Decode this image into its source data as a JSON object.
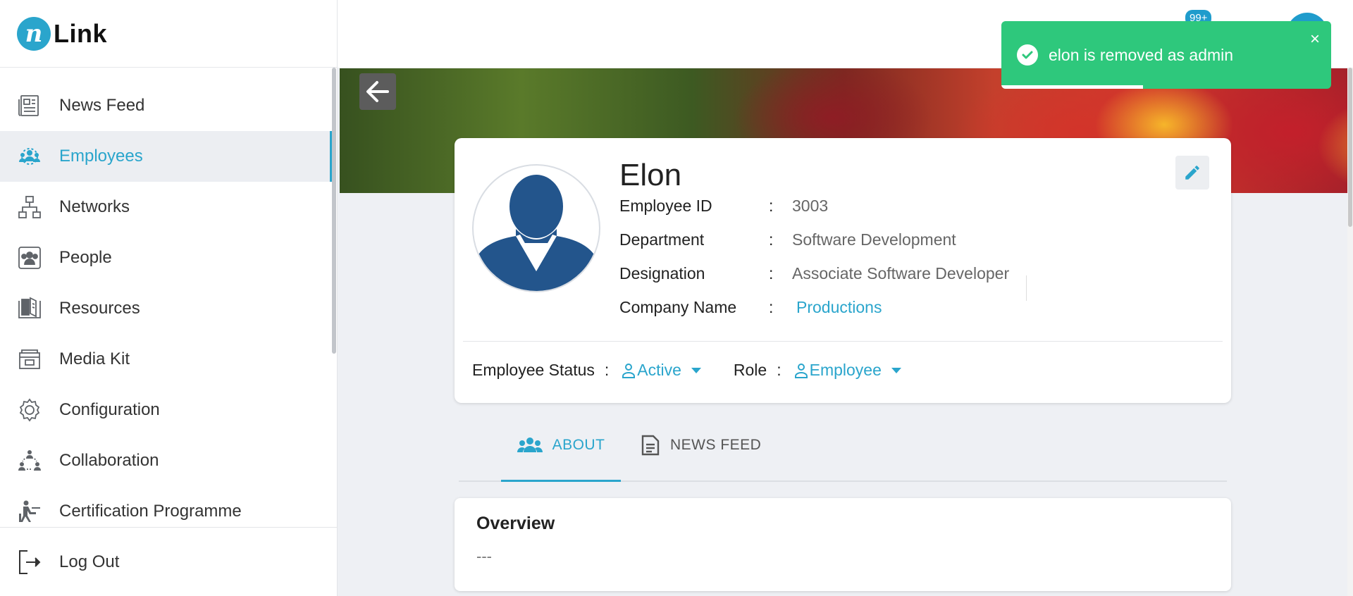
{
  "app": {
    "logo_text": "Link"
  },
  "sidebar": {
    "items": [
      {
        "label": "News Feed",
        "icon": "newspaper-icon"
      },
      {
        "label": "Employees",
        "icon": "employees-icon",
        "active": true
      },
      {
        "label": "Networks",
        "icon": "network-icon"
      },
      {
        "label": "People",
        "icon": "people-icon"
      },
      {
        "label": "Resources",
        "icon": "book-icon"
      },
      {
        "label": "Media Kit",
        "icon": "media-kit-icon"
      },
      {
        "label": "Configuration",
        "icon": "gear-icon"
      },
      {
        "label": "Collaboration",
        "icon": "collaboration-icon"
      },
      {
        "label": "Certification Programme",
        "icon": "certification-icon"
      }
    ],
    "logout_label": "Log Out"
  },
  "topbar": {
    "notification_count": "99+"
  },
  "profile": {
    "name": "Elon",
    "fields": [
      {
        "label": "Employee ID",
        "value": "3003"
      },
      {
        "label": "Department",
        "value": "Software Development"
      },
      {
        "label": "Designation",
        "value": "Associate Software Developer"
      },
      {
        "label": "Company Name",
        "value": "Productions"
      }
    ],
    "colon": ":",
    "employee_status_label": "Employee Status",
    "employee_status_value": "Active",
    "role_label": "Role",
    "role_value": "Employee"
  },
  "tabs": [
    {
      "label": "ABOUT",
      "active": true
    },
    {
      "label": "NEWS FEED",
      "active": false
    }
  ],
  "overview": {
    "title": "Overview",
    "body": "---"
  },
  "toast": {
    "message": "elon is removed as admin",
    "close": "×",
    "progress": 0.43
  },
  "colors": {
    "accent": "#2aa5cc",
    "toast": "#2ec87c",
    "avatar": "#23558c"
  }
}
